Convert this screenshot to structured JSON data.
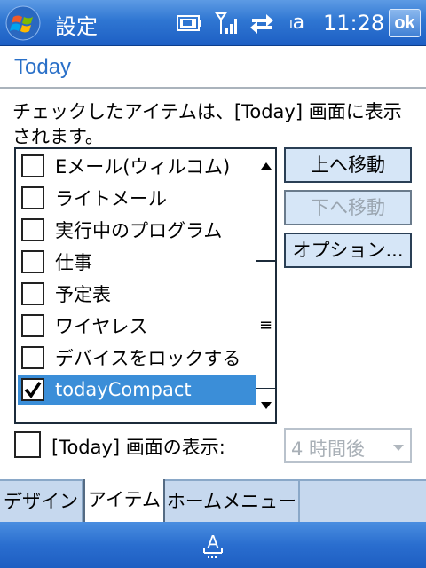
{
  "titlebar": {
    "title": "設定",
    "ime_indicator": "ₗa",
    "clock": "11:28",
    "ok_label": "ok"
  },
  "page": {
    "header": "Today",
    "instructions": "チェックしたアイテムは、[Today] 画面に表示されます。"
  },
  "items": [
    {
      "label": "Eメール(ウィルコム)",
      "checked": false
    },
    {
      "label": "ライトメール",
      "checked": false
    },
    {
      "label": "実行中のプログラム",
      "checked": false
    },
    {
      "label": "仕事",
      "checked": false
    },
    {
      "label": "予定表",
      "checked": false
    },
    {
      "label": "ワイヤレス",
      "checked": false
    },
    {
      "label": "デバイスをロックする",
      "checked": false
    },
    {
      "label": "todayCompact",
      "checked": true,
      "selected": true
    }
  ],
  "buttons": {
    "move_up": "上へ移動",
    "move_down": "下へ移動",
    "options": "オプション..."
  },
  "show_today": {
    "label": "[Today] 画面の表示:",
    "checked": false,
    "timeout_value": "4 時間後"
  },
  "tabs": [
    {
      "label": "デザイン",
      "active": false
    },
    {
      "label": "アイテム",
      "active": true
    },
    {
      "label": "ホームメニュー",
      "active": false
    }
  ],
  "colors": {
    "titlebar": "#2f76d2",
    "accent": "#2a70c8",
    "selection": "#3b8ed8",
    "button_face": "#d6e6f7",
    "tab_strip": "#c6d8ee"
  },
  "icons": {
    "start": "windows-flag-icon",
    "battery": "battery-icon",
    "signal": "signal-icon",
    "sync": "sync-arrows-icon",
    "sip": "keyboard-sip-icon"
  }
}
